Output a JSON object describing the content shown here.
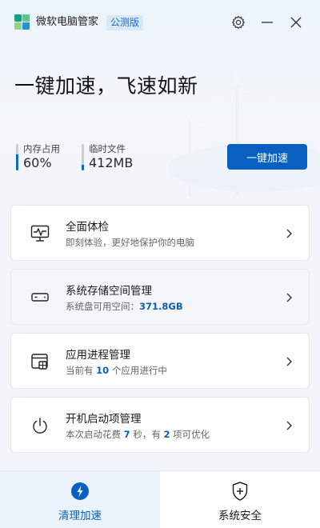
{
  "app": {
    "name": "微软电脑管家",
    "edition": "公测版",
    "logo_colors": [
      "#1aa07e",
      "#5fc58c",
      "#93d28a",
      "#1aa07e"
    ]
  },
  "titlebar": {
    "settings_icon": "gear-icon",
    "minimize_icon": "minimize-icon",
    "close_icon": "close-icon"
  },
  "hero": {
    "title": "一键加速，飞速如新"
  },
  "stats": {
    "memory": {
      "label": "内存占用",
      "value": "60%",
      "level": 0.6
    },
    "temp_files": {
      "label": "临时文件",
      "value": "412MB",
      "level": 0.2
    }
  },
  "boost_button": {
    "label": "一键加速"
  },
  "cards": [
    {
      "icon": "health-check-icon",
      "title": "全面体检",
      "desc_parts": [
        "即刻体验，更好地保护你的电脑"
      ]
    },
    {
      "icon": "storage-icon",
      "title": "系统存储空间管理",
      "desc_parts": [
        "系统盘可用空间：",
        "371.8GB",
        ""
      ]
    },
    {
      "icon": "process-icon",
      "title": "应用进程管理",
      "desc_parts": [
        "当前有 ",
        "10",
        " 个应用进行中"
      ]
    },
    {
      "icon": "power-icon",
      "title": "开机启动项管理",
      "desc_parts": [
        "本次启动花费 ",
        "7",
        " 秒，有 ",
        "2",
        " 项可优化"
      ]
    }
  ],
  "nav": {
    "items": [
      {
        "label": "清理加速",
        "icon": "lightning-icon",
        "active": true
      },
      {
        "label": "系统安全",
        "icon": "shield-plus-icon",
        "active": false
      }
    ]
  },
  "colors": {
    "accent": "#0a60c0",
    "highlight_text": "#0c5fb5",
    "badge_bg": "#d7e8f8"
  }
}
